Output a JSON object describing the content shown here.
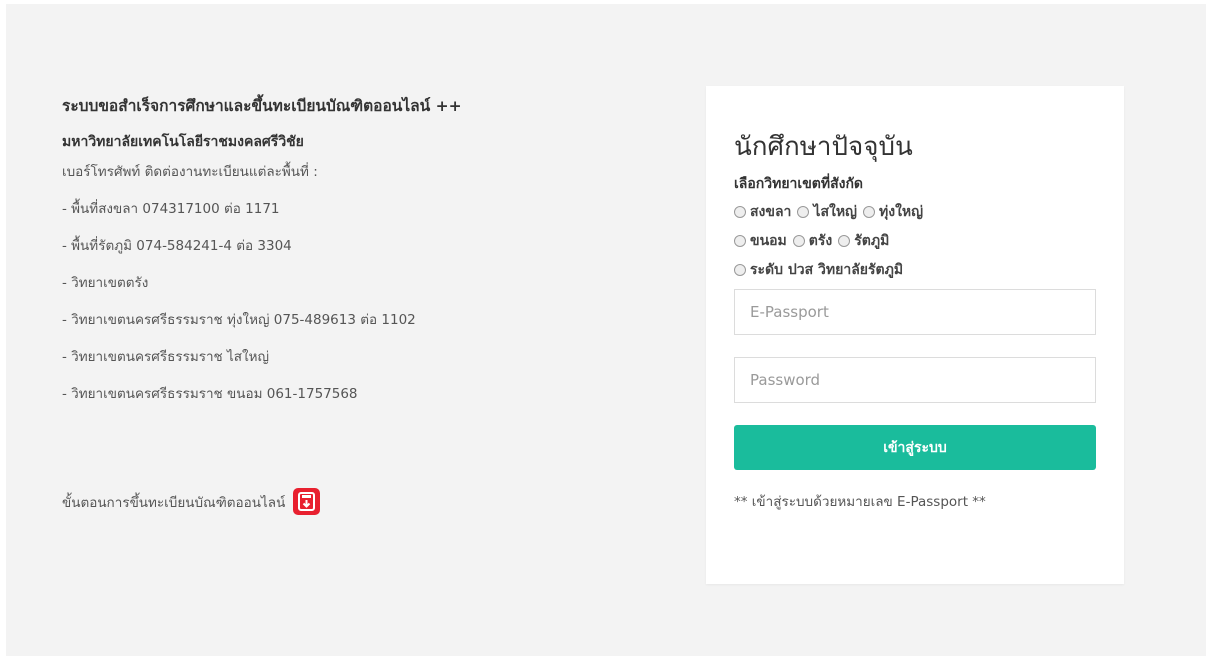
{
  "info": {
    "title": "ระบบขอสำเร็จการศึกษาและขึ้นทะเบียนบัณฑิตออนไลน์ ++",
    "university": "มหาวิทยาลัยเทคโนโลยีราชมงคลศรีวิชัย",
    "phone_heading": "เบอร์โทรศัพท์ ติดต่องานทะเบียนแต่ละพื้นที่ :",
    "contacts": [
      "- พื้นที่สงขลา 074317100 ต่อ 1171",
      "- พื้นที่รัตภูมิ 074-584241-4 ต่อ 3304",
      "- วิทยาเขตตรัง",
      "- วิทยาเขตนครศรีธรรมราช ทุ่งใหญ่ 075-489613 ต่อ 1102",
      "- วิทยาเขตนครศรีธรรมราช ไสใหญ่",
      "- วิทยาเขตนครศรีธรรมราช ขนอม 061-1757568"
    ],
    "steps_label": "ขั้นตอนการขึ้นทะเบียนบัณฑิตออนไลน์",
    "steps_icon": "pdf-icon"
  },
  "login": {
    "title": "นักศึกษาปัจจุบัน",
    "campus_label": "เลือกวิทยาเขตที่สังกัด",
    "campuses": [
      "สงขลา",
      "ไสใหญ่",
      "ทุ่งใหญ่",
      "ขนอม",
      "ตรัง",
      "รัตภูมิ",
      "ระดับ ปวส วิทยาลัยรัตภูมิ"
    ],
    "username_placeholder": "E-Passport",
    "password_placeholder": "Password",
    "submit_label": "เข้าสู่ระบบ",
    "note": "** เข้าสู่ระบบด้วยหมายเลข E-Passport **"
  },
  "colors": {
    "accent": "#1abc9c",
    "pdf_icon": "#e8202f",
    "background": "#f3f3f3"
  }
}
